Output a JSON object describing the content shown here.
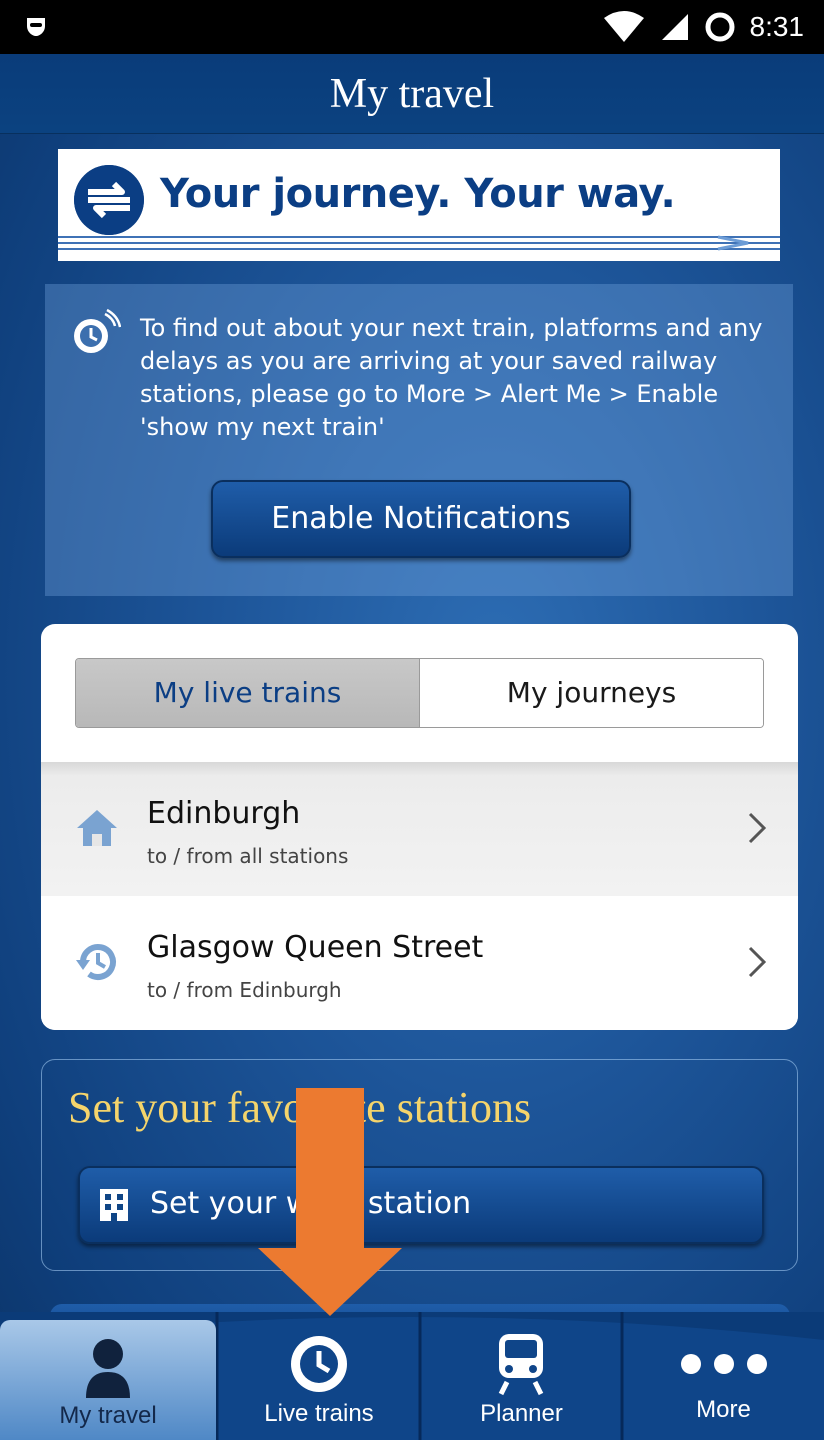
{
  "status_bar": {
    "time": "8:31"
  },
  "header": {
    "title": "My travel"
  },
  "banner": {
    "text": "Your journey. Your way."
  },
  "notice": {
    "text": "To find out about your next train, platforms and any delays as you are arriving at your saved railway stations, please go to More > Alert Me > Enable 'show my next train'",
    "button_label": "Enable Notifications"
  },
  "segmented": {
    "tabs": [
      {
        "label": "My live trains",
        "active": true
      },
      {
        "label": "My journeys",
        "active": false
      }
    ]
  },
  "saved_items": [
    {
      "title": "Edinburgh",
      "subtitle": "to / from all stations",
      "icon": "home-icon"
    },
    {
      "title": "Glasgow Queen Street",
      "subtitle": "to / from Edinburgh",
      "icon": "history-icon"
    }
  ],
  "favourites": {
    "title": "Set your favourite stations",
    "work_button_label": "Set your work station"
  },
  "tabbar": {
    "items": [
      {
        "label": "My travel",
        "icon": "person-icon",
        "active": true
      },
      {
        "label": "Live trains",
        "icon": "clock-icon",
        "active": false
      },
      {
        "label": "Planner",
        "icon": "train-icon",
        "active": false
      },
      {
        "label": "More",
        "icon": "more-dots-icon",
        "active": false
      }
    ]
  },
  "colors": {
    "brand": "#0b3e84",
    "accent_yellow": "#f5d46b",
    "annotation_arrow": "#ec7a30"
  }
}
